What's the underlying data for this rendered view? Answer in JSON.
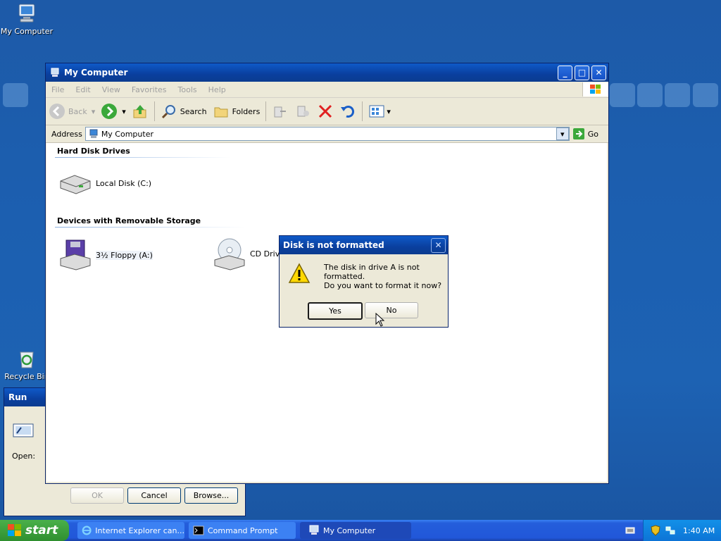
{
  "desktop": {
    "my_computer_label": "My Computer",
    "recycle_bin_label": "Recycle Bin"
  },
  "run_dialog": {
    "title": "Run",
    "open_label": "Open:",
    "ok_label": "OK",
    "cancel_label": "Cancel",
    "browse_label": "Browse..."
  },
  "explorer": {
    "title": "My Computer",
    "menu": [
      "File",
      "Edit",
      "View",
      "Favorites",
      "Tools",
      "Help"
    ],
    "toolbar": {
      "back_label": "Back",
      "search_label": "Search",
      "folders_label": "Folders"
    },
    "address": {
      "label": "Address",
      "value": "My Computer",
      "go_label": "Go"
    },
    "groups": {
      "hard_disks": {
        "title": "Hard Disk Drives",
        "items": [
          "Local Disk (C:)"
        ]
      },
      "removable": {
        "title": "Devices with Removable Storage",
        "items": [
          "3½ Floppy (A:)",
          "CD Drive"
        ]
      }
    }
  },
  "dialog": {
    "title": "Disk is not formatted",
    "message_line1": "The disk in drive A is not formatted.",
    "message_line2": "Do you want to format it now?",
    "yes_label": "Yes",
    "no_label": "No"
  },
  "taskbar": {
    "start_label": "start",
    "tasks": [
      "Internet Explorer can...",
      "Command Prompt",
      "My Computer"
    ],
    "time": "1:40 AM"
  },
  "colors": {
    "desktop": "#1d5aa8",
    "title_bar": "#0a3f9e",
    "taskbar": "#245edb",
    "start_button": "#3c9a3c"
  }
}
